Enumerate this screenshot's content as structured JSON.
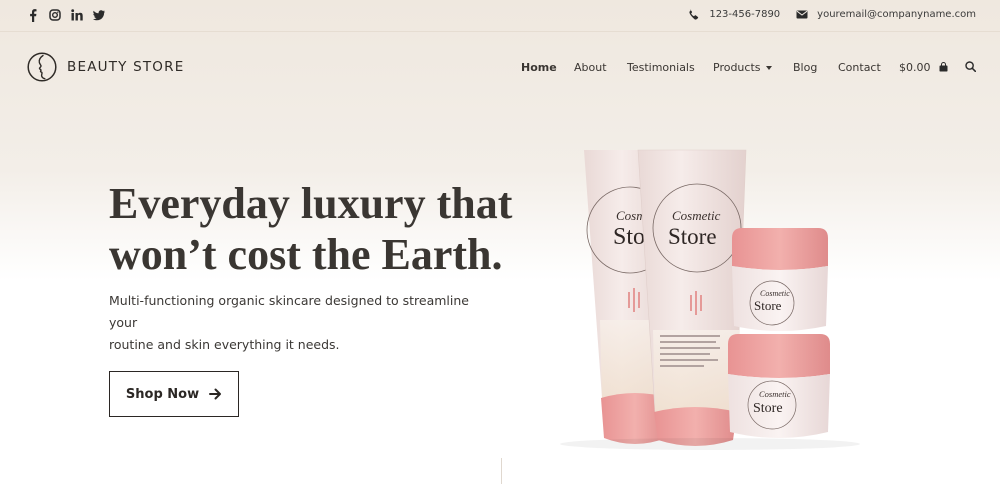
{
  "topbar": {
    "social": [
      "facebook-icon",
      "instagram-icon",
      "linkedin-icon",
      "twitter-icon"
    ],
    "phone": "123-456-7890",
    "email": "youremail@companyname.com"
  },
  "header": {
    "logo_text": "BEAUTY STORE",
    "nav": [
      "Home",
      "About",
      "Testimonials",
      "Products",
      "Blog",
      "Contact"
    ],
    "cart_total": "$0.00"
  },
  "hero": {
    "headline_line1": "Everyday luxury that",
    "headline_line2": "won’t cost the Earth.",
    "subtext_line1": "Multi-functioning organic skincare designed to streamline your",
    "subtext_line2": "routine and skin everything it needs.",
    "button_label": "Shop Now"
  },
  "product_image": {
    "label_line1": "Cosmetic",
    "label_line2": "Store",
    "label_partial_line1": "Cosm",
    "label_partial_line2": "Sto"
  },
  "colors": {
    "accent": "#e7a0a0",
    "text_dark": "#2e2b28",
    "tube_cream": "#f3e6e3"
  }
}
